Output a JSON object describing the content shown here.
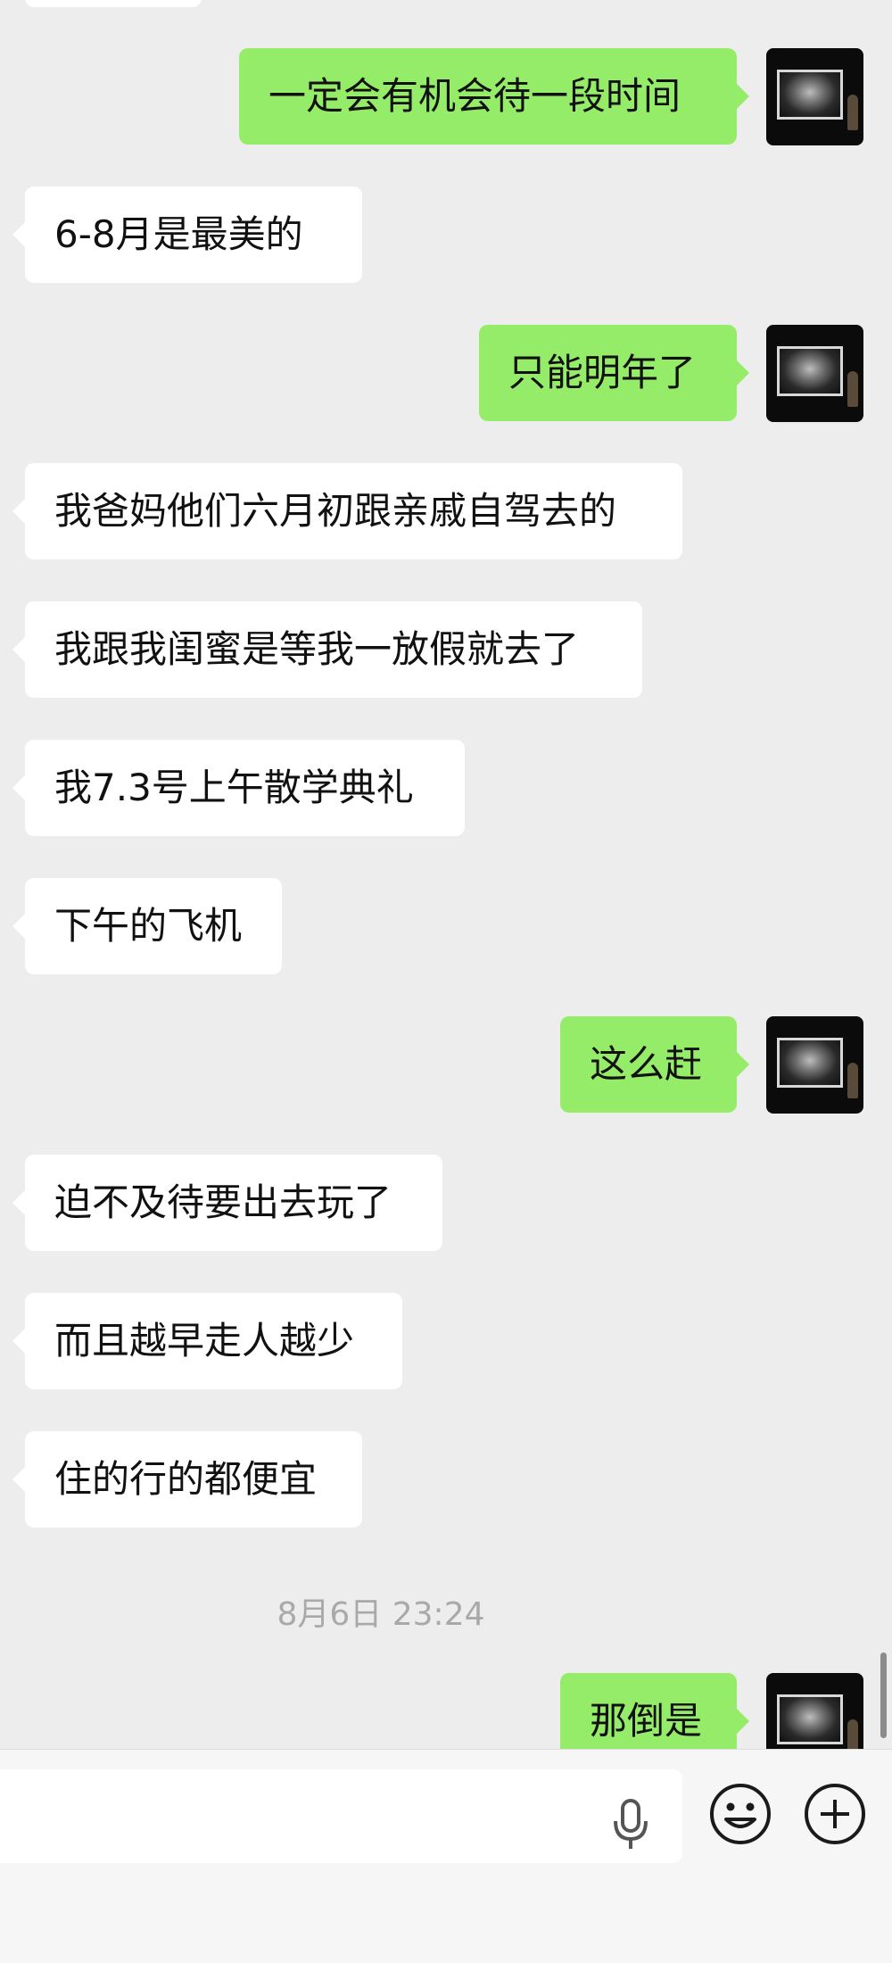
{
  "messages": [
    {
      "side": "out",
      "text": "一定会有机会待一段时间"
    },
    {
      "side": "in",
      "text": "6-8月是最美的"
    },
    {
      "side": "out",
      "text": "只能明年了"
    },
    {
      "side": "in",
      "text": "我爸妈他们六月初跟亲戚自驾去的"
    },
    {
      "side": "in",
      "text": "我跟我闺蜜是等我一放假就去了"
    },
    {
      "side": "in",
      "text": "我7.3号上午散学典礼"
    },
    {
      "side": "in",
      "text": "下午的飞机"
    },
    {
      "side": "out",
      "text": "这么赶"
    },
    {
      "side": "in",
      "text": "迫不及待要出去玩了"
    },
    {
      "side": "in",
      "text": "而且越早走人越少"
    },
    {
      "side": "in",
      "text": "住的行的都便宜"
    },
    {
      "side": "out",
      "text": "那倒是"
    }
  ],
  "timestamp": "8月6日 23:24",
  "input_bar": {
    "voice_icon": "microphone-icon",
    "emoji_icon": "smiley-icon",
    "more_icon": "plus-circle-icon"
  },
  "colors": {
    "background": "#ededed",
    "incoming_bubble": "#ffffff",
    "outgoing_bubble": "#95ec69"
  }
}
